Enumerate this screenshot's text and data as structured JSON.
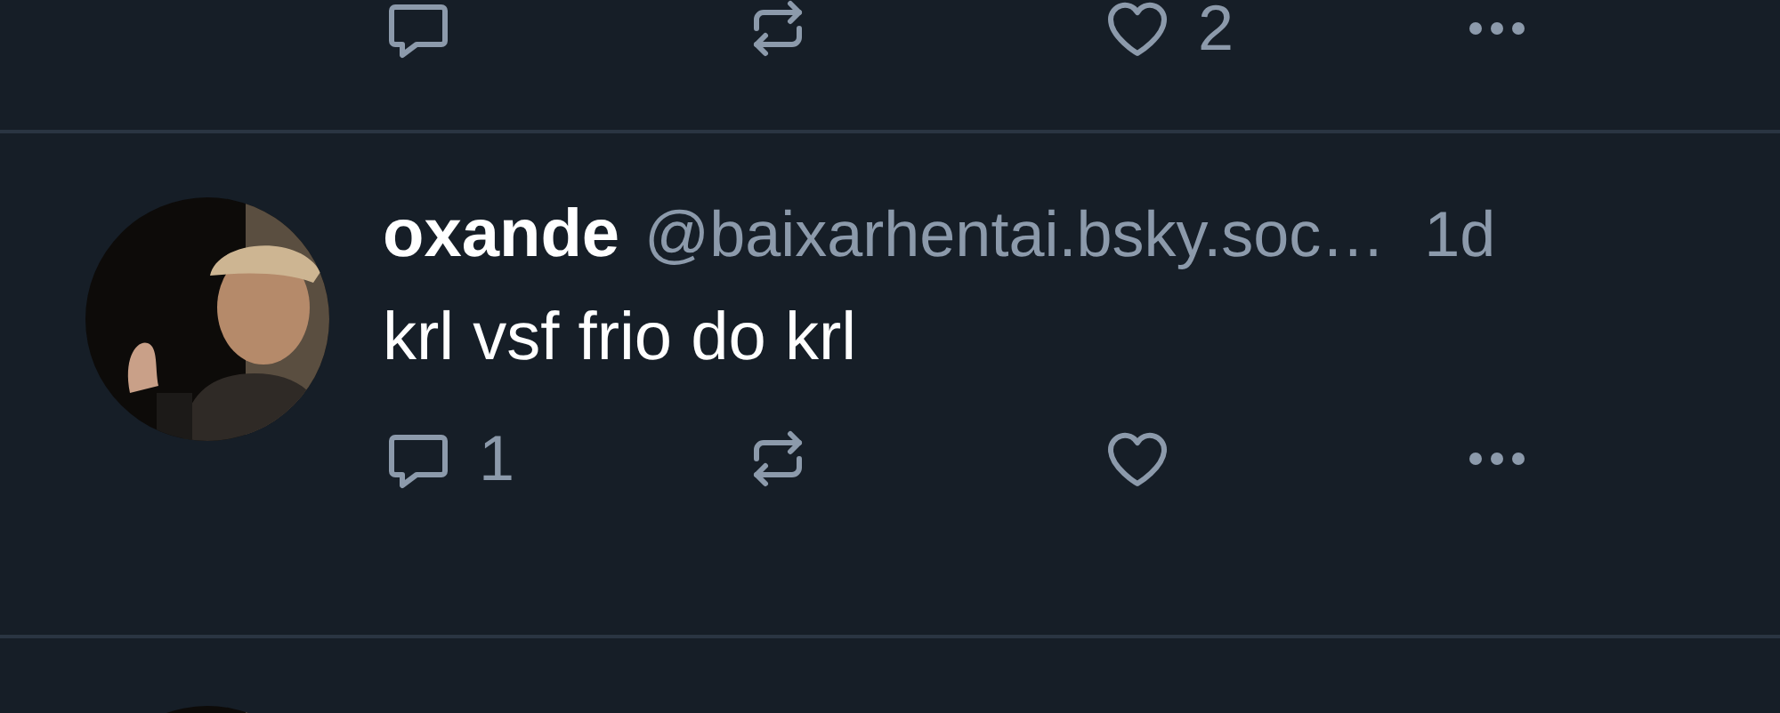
{
  "previous_post": {
    "actions": [
      {
        "kind": "reply"
      },
      {
        "kind": "repost"
      },
      {
        "kind": "like",
        "count": "2"
      },
      {
        "kind": "more"
      }
    ]
  },
  "post": {
    "author": {
      "display_name": "oxande",
      "handle": "@baixarhentai.bsky.soc…"
    },
    "time": "1d",
    "text": "krl vsf frio do krl",
    "actions": [
      {
        "kind": "reply",
        "count": "1"
      },
      {
        "kind": "repost"
      },
      {
        "kind": "like"
      },
      {
        "kind": "more"
      }
    ]
  }
}
